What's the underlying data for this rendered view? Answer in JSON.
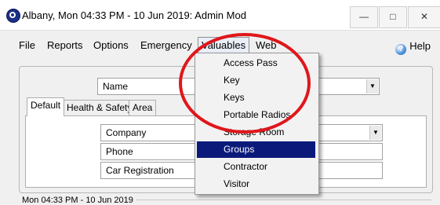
{
  "window": {
    "title": "Albany, Mon 04:33 PM - 10 Jun 2019: Admin Mod",
    "minimize_symbol": "—",
    "maximize_symbol": "□",
    "close_symbol": "✕"
  },
  "menubar": {
    "items": [
      "File",
      "Reports",
      "Options",
      "Emergency",
      "Valuables",
      "Web"
    ],
    "active": "Valuables",
    "help_label": "Help"
  },
  "form": {
    "top_select_value": "Name",
    "tabs": [
      "Default",
      "Health & Safety",
      "Area"
    ],
    "active_tab": "Default",
    "company_value": "Company",
    "phone_value": "Phone",
    "car_registration_value": "Car Registration",
    "status_text": "Mon 04:33 PM - 10 Jun 2019"
  },
  "valuables_menu": {
    "items": [
      "Access Pass",
      "Key",
      "Keys",
      "Portable Radios",
      "Storage Room",
      "Groups",
      "Contractor",
      "Visitor"
    ],
    "highlighted": "Groups"
  },
  "icons": {
    "app": "app-logo-icon",
    "help": "help-globe-icon",
    "dropdown": "chevron-down-icon"
  },
  "colors": {
    "menu_highlight": "#0b1a7a",
    "annotation_circle": "#e0161b"
  }
}
